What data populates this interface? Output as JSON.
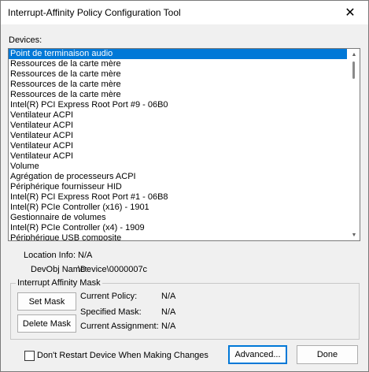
{
  "window": {
    "title": "Interrupt-Affinity Policy Configuration Tool",
    "close_glyph": "✕"
  },
  "devices": {
    "label": "Devices:",
    "items": [
      "Point de terminaison audio",
      "Ressources de la carte mère",
      "Ressources de la carte mère",
      "Ressources de la carte mère",
      "Ressources de la carte mère",
      "Intel(R) PCI Express Root Port #9 - 06B0",
      "Ventilateur ACPI",
      "Ventilateur ACPI",
      "Ventilateur ACPI",
      "Ventilateur ACPI",
      "Ventilateur ACPI",
      "Volume",
      "Agrégation de processeurs ACPI",
      "Périphérique fournisseur HID",
      "Intel(R) PCI Express Root Port #1 - 06B8",
      "Intel(R) PCIe Controller (x16) - 1901",
      "Gestionnaire de volumes",
      "Intel(R) PCIe Controller (x4) - 1909",
      "Périphérique USB composite"
    ],
    "selected_index": 0
  },
  "info": {
    "location_label": "Location Info:",
    "location_value": "N/A",
    "devobj_label": "DevObj Name:",
    "devobj_value": "\\Device\\0000007c"
  },
  "mask": {
    "group_title": "Interrupt Affinity Mask",
    "set_mask_label": "Set Mask",
    "delete_mask_label": "Delete Mask",
    "current_policy_label": "Current Policy:",
    "current_policy_value": "N/A",
    "specified_mask_label": "Specified Mask:",
    "specified_mask_value": "N/A",
    "current_assignment_label": "Current Assignment:",
    "current_assignment_value": "N/A"
  },
  "footer": {
    "dont_restart_label": "Don't Restart Device When Making Changes",
    "advanced_label": "Advanced...",
    "done_label": "Done"
  }
}
